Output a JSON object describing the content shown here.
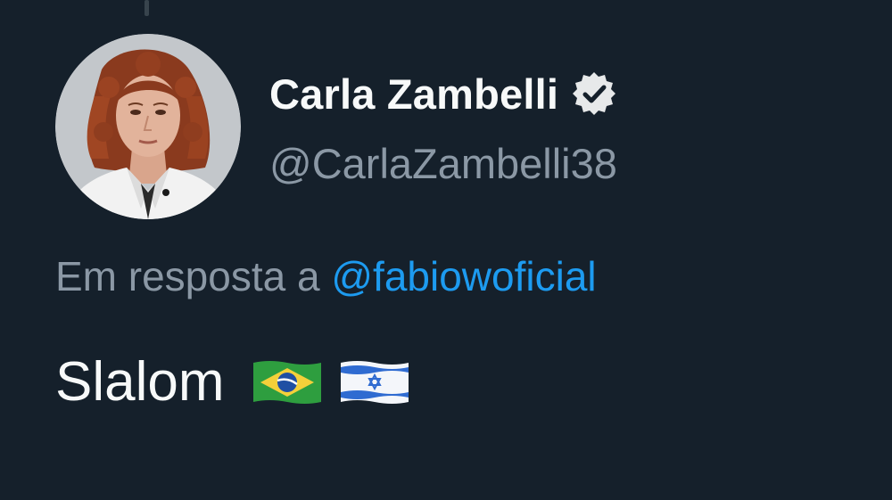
{
  "author": {
    "display_name": "Carla Zambelli",
    "handle": "@CarlaZambelli38",
    "verified_icon": "verified-badge-icon"
  },
  "reply": {
    "prefix": "Em resposta a",
    "mention": "@fabiowoficial"
  },
  "tweet": {
    "text": "Slalom",
    "emoji": [
      "brazil-flag",
      "israel-flag"
    ]
  },
  "colors": {
    "background": "#15202b",
    "primary_text": "#f7f9f9",
    "secondary_text": "#8b98a5",
    "link": "#1d9bf0"
  }
}
